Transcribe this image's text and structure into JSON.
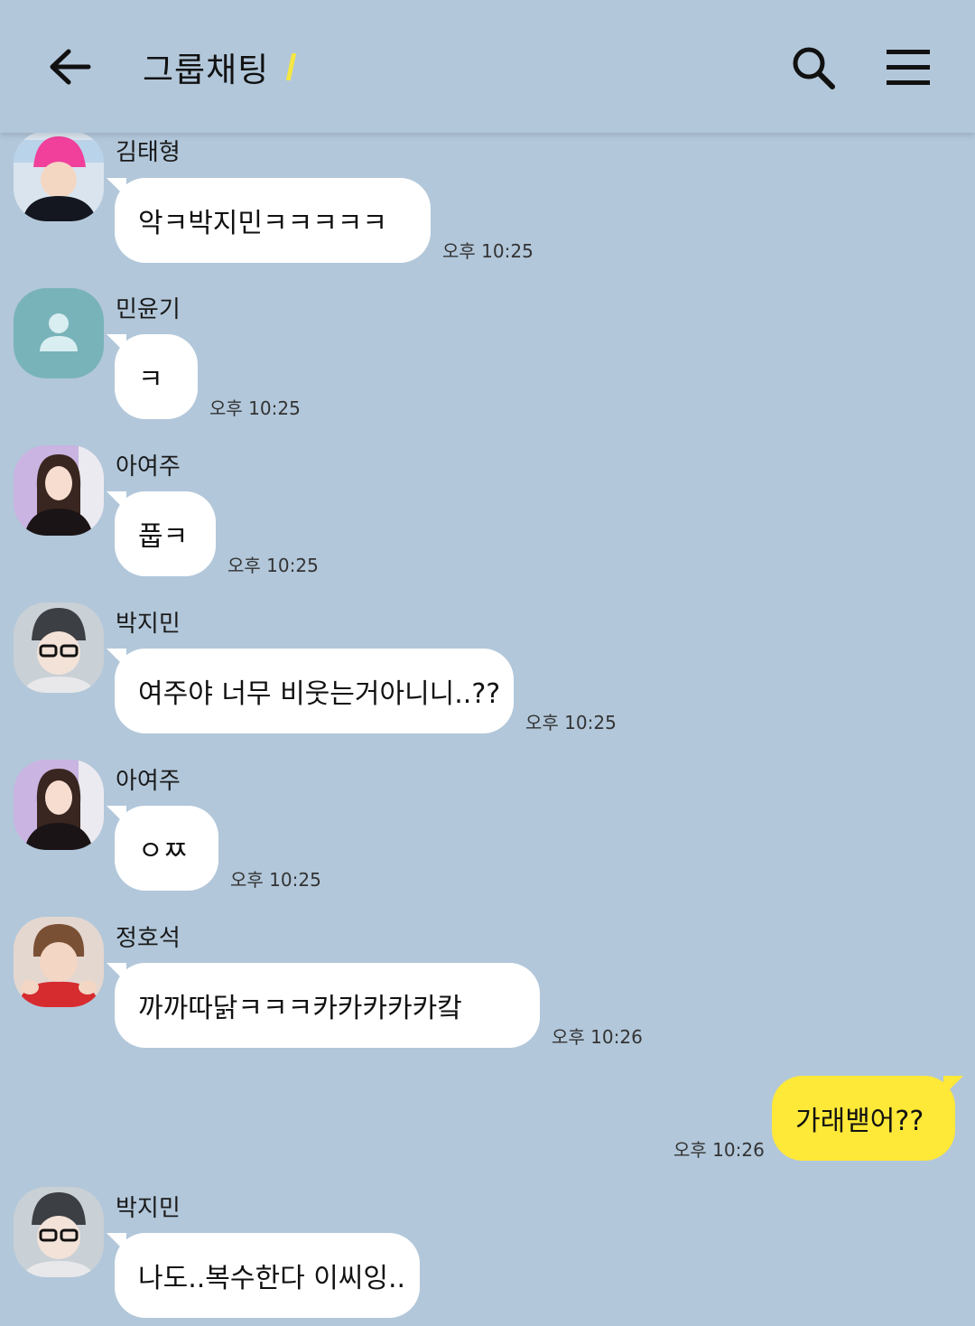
{
  "header": {
    "title": "그룹채팅"
  },
  "messages": [
    {
      "sender": "김태형",
      "text": "악ㅋ박지민ㅋㅋㅋㅋㅋ",
      "time": "오후 10:25"
    },
    {
      "sender": "민윤기",
      "text": "ㅋ",
      "time": "오후 10:25"
    },
    {
      "sender": "아여주",
      "text": "풉ㅋ",
      "time": "오후 10:25"
    },
    {
      "sender": "박지민",
      "text": "여주야 너무 비웃는거아니니..??",
      "time": "오후 10:25"
    },
    {
      "sender": "아여주",
      "text": "ㅇㅉ",
      "time": "오후 10:25"
    },
    {
      "sender": "정호석",
      "text": "까까따닭ㅋㅋㅋ카카카카카캌",
      "time": "오후 10:26"
    },
    {
      "mine": true,
      "text": "가래밷어??",
      "time": "오후 10:26"
    },
    {
      "sender": "박지민",
      "text": "나도..복수한다 이씨잉..",
      "time": ""
    }
  ],
  "colors": {
    "background": "#b2c7da",
    "my_bubble": "#fee838",
    "other_bubble": "#ffffff"
  },
  "icons": [
    "back-arrow-icon",
    "search-icon",
    "menu-icon",
    "default-profile-icon"
  ]
}
